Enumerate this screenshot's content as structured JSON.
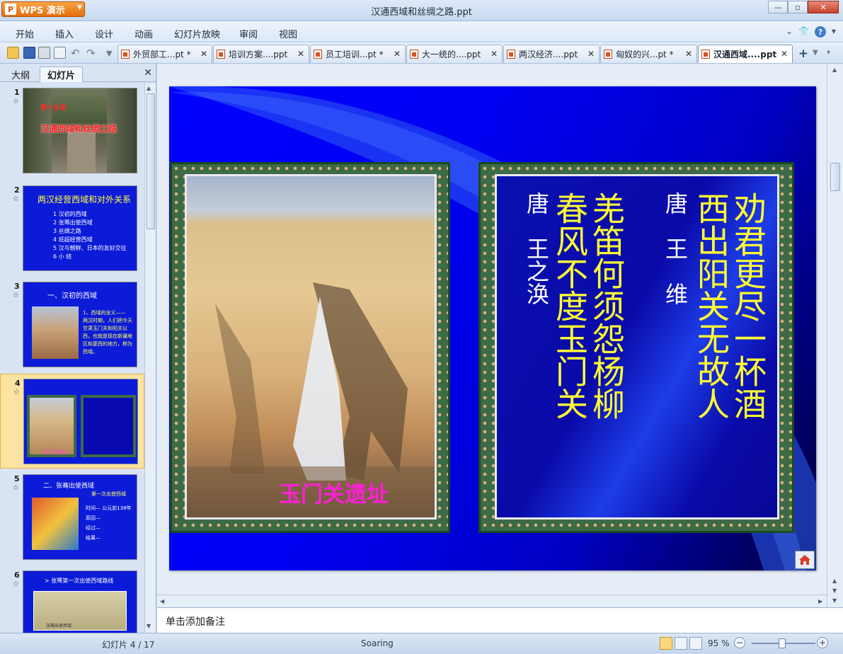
{
  "app": {
    "brand": "WPS 演示",
    "window_title": "汉通西域和丝绸之路.ppt",
    "window_buttons": [
      "minimize-icon",
      "maximize-icon",
      "close-icon"
    ]
  },
  "menu": [
    "开始",
    "插入",
    "设计",
    "动画",
    "幻灯片放映",
    "审阅",
    "视图"
  ],
  "doc_tabs": [
    {
      "label": "外贸部工...pt *",
      "active": false
    },
    {
      "label": "培训方案....ppt",
      "active": false
    },
    {
      "label": "员工培训...pt *",
      "active": false
    },
    {
      "label": "大一统的....ppt",
      "active": false
    },
    {
      "label": "两汉经济....ppt",
      "active": false
    },
    {
      "label": "匈奴的兴...pt *",
      "active": false
    },
    {
      "label": "汉通西域....ppt",
      "active": true
    }
  ],
  "panel": {
    "tabs": [
      "大纲",
      "幻灯片"
    ],
    "active_tab": "幻灯片",
    "thumbnails": [
      {
        "num": "1",
        "star": "☆",
        "lines": [
          "第十五课",
          "汉通西域和丝绸之路"
        ]
      },
      {
        "num": "2",
        "star": "☆",
        "lines": [
          "两汉经营西域和对外关系",
          "1 汉初的西域",
          "2 张骞出使西域",
          "3 丝绸之路",
          "4 班超经营西域",
          "5 汉与朝鲜、日本的友好交往",
          "6 小 结"
        ]
      },
      {
        "num": "3",
        "star": "☆",
        "lines": [
          "一、汉初的西域",
          "1、西域的含义——",
          "两汉时期，人们把今天甘肃玉门关和阳关以西，也就是现在新疆地区和更西的地方，称为西域。"
        ]
      },
      {
        "num": "4",
        "star": "☆",
        "lines": [
          "玉门关遗址"
        ]
      },
      {
        "num": "5",
        "star": "☆",
        "lines": [
          "二、张骞出使西域",
          "第一次出使西域",
          "时间— 公元前138年",
          "原因—",
          "经过—",
          "结果—",
          "联合大月氏夹击匈奴"
        ]
      },
      {
        "num": "6",
        "star": "☆",
        "lines": [
          "> 张骞第一次出使西域路线",
          "张骞出使西域"
        ]
      }
    ],
    "selected": 3
  },
  "slide": {
    "caption": "玉门关遗址",
    "poem1_title_author": "唐 王维",
    "poem1_col1": "劝君更尽一杯酒",
    "poem1_col2": "西出阳关无故人",
    "poem1_author": "唐　王　维",
    "poem2_col1": "羌笛何须怨杨柳",
    "poem2_col2": "春风不度玉门关",
    "poem2_author": "唐　王之涣",
    "home_icon": "home-icon"
  },
  "notes_placeholder": "单击添加备注",
  "status": {
    "slide_count": "幻灯片 4 / 17",
    "theme": "Soaring",
    "zoom": "95 %",
    "zoom_level": 0.95
  },
  "colors": {
    "slide_blue": "#0000ff",
    "frame_green": "#3c6b45",
    "poem_yellow": "#ffff33",
    "caption_magenta": "#ff1fd6",
    "accent_orange": "#e46e10"
  }
}
